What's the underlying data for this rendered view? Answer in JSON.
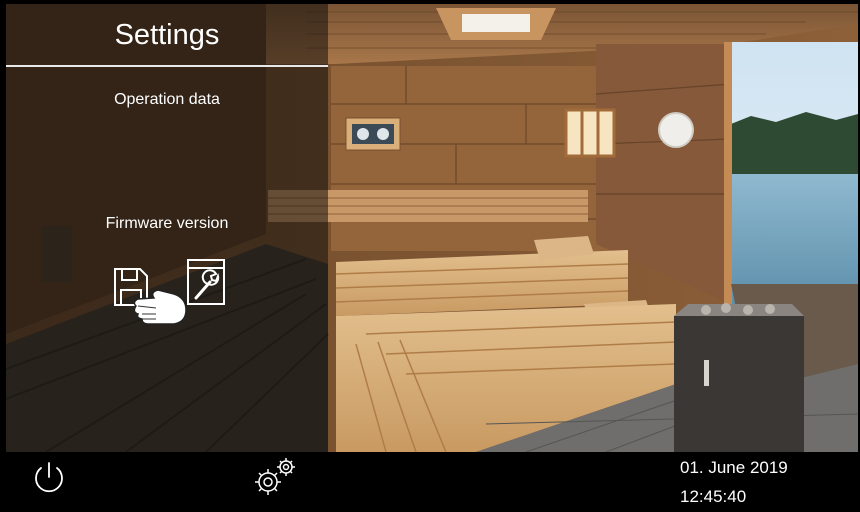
{
  "panel": {
    "title": "Settings",
    "items": [
      {
        "label": "Operation data"
      },
      {
        "label": "Firmware version"
      }
    ],
    "icons": [
      "save-icon",
      "wrench-icon"
    ]
  },
  "footer": {
    "date": "01. June 2019",
    "time": "12:45:40",
    "icons": [
      "power-icon",
      "gears-icon"
    ]
  },
  "colors": {
    "wood_light": "#c9935d",
    "wood_dark": "#6b4a2e",
    "panel_overlay": "#14100c",
    "bar": "#000000",
    "text": "#ffffff"
  }
}
